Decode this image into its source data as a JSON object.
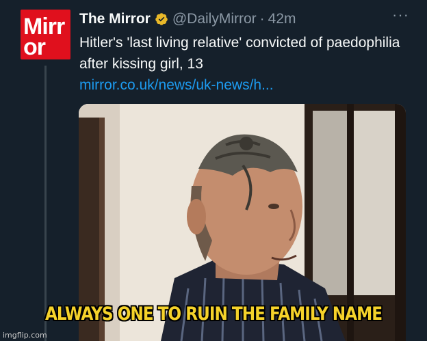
{
  "account": {
    "avatar_text_top": "Mirr",
    "avatar_text_bottom": "or",
    "display_name": "The Mirror",
    "handle": "@DailyMirror",
    "separator": "·",
    "time": "42m",
    "more_label": "···"
  },
  "tweet": {
    "text": "Hitler's 'last living relative' convicted of paedophilia after kissing girl, 13",
    "link": "mirror.co.uk/news/uk-news/h..."
  },
  "meme": {
    "caption": "ALWAYS ONE TO RUIN THE FAMILY NAME",
    "watermark": "imgflip.com"
  },
  "colors": {
    "background": "#15202b",
    "link": "#1d9bf0",
    "verified_badge": "#e8b829",
    "brand_red": "#e0101d",
    "caption": "#f5d22a"
  },
  "icons": {
    "verified": "verified-badge-icon",
    "more": "more-options-icon"
  }
}
